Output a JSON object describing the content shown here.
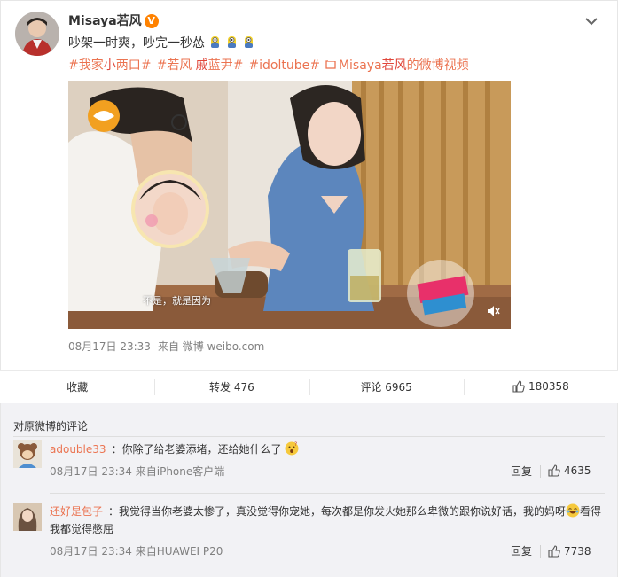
{
  "post": {
    "username": "Misaya若风",
    "verified_mark": "V",
    "text": "吵架一时爽，吵完一秒怂",
    "topics": {
      "t1a": "#我家",
      "t1b": "小",
      "t1c": "两口#",
      "t2a": "#若风",
      "t2b": "戚",
      "t2c": "蓝尹#",
      "t3": "#idoltube#",
      "t4a": "Misaya",
      "t4b": "若风",
      "t4c": "的微博视频"
    },
    "video_subtitle": "不是，就是因为",
    "time": "08月17日 23:33",
    "source": "来自 微博 weibo.com"
  },
  "actions": {
    "collect": "收藏",
    "repost": "转发 476",
    "comment": "评论 6965",
    "like": "180358"
  },
  "comments": {
    "header": "对原微博的评论",
    "items": [
      {
        "user": "adouble33",
        "text": "：你除了给老婆添堵，还给她什么了",
        "time": "08月17日 23:34 来自iPhone客户端",
        "reply": "回复",
        "likes": "4635"
      },
      {
        "user": "还好是包子",
        "text_a": "：我觉得当你老婆太惨了，真没觉得你宠她，每次都是你发火她那么卑微的跟你说好话，我的妈呀",
        "text_b": "看得我都觉得憋屈",
        "time": "08月17日 23:34 来自HUAWEI P20",
        "reply": "回复",
        "likes": "7738"
      }
    ]
  },
  "colors": {
    "link": "#eb7350",
    "accent": "#ff8200",
    "meta_gray": "#808080",
    "comment_bg": "#f2f2f5"
  },
  "icons": [
    "chevron-down-icon",
    "verified-icon",
    "link-icon",
    "mute-icon",
    "thumbs-up-icon",
    "surprised-emoji-icon",
    "laughing-emoji-icon"
  ]
}
